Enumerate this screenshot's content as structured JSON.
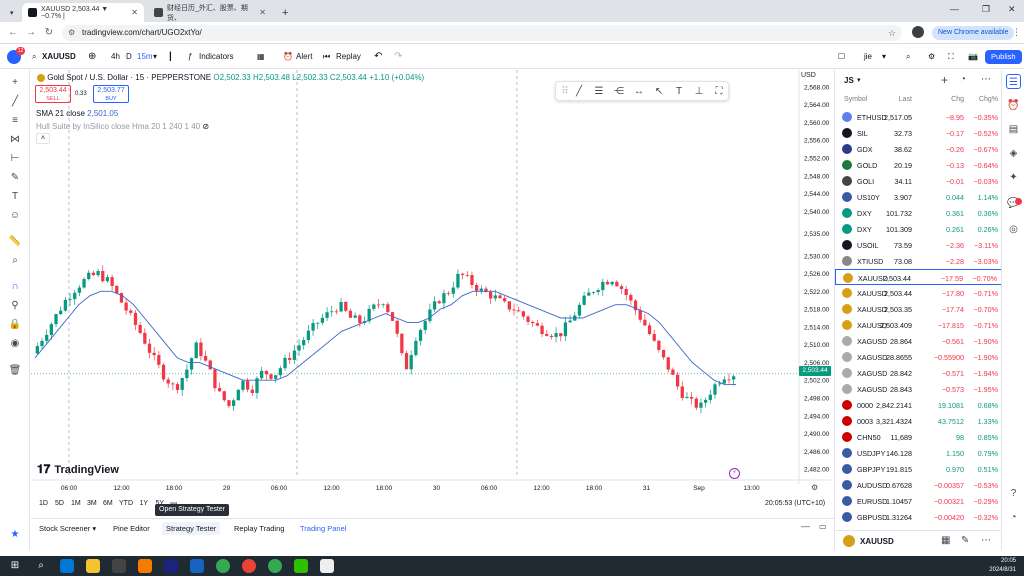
{
  "browser": {
    "tabs": [
      {
        "title": "XAUUSD 2,503.44 ▼ −0.7% |",
        "active": true
      },
      {
        "title": "财经日历_外汇、股票、期货、",
        "active": false
      }
    ],
    "url": "tradingview.com/chart/UGO2xtYo/",
    "new_chrome": "New Chrome available",
    "new_tab_icon": "plus-icon"
  },
  "toolbar": {
    "badge": "12",
    "symbol": "XAUUSD",
    "intervals": [
      "4h",
      "D",
      "15m"
    ],
    "indicators_label": "Indicators",
    "alert_label": "Alert",
    "replay_label": "Replay",
    "user": "jie",
    "publish_label": "Publish"
  },
  "chart": {
    "title": "Gold Spot / U.S. Dollar · 15 · PEPPERSTONE",
    "ohlc": "O2,502.33 H2,503.48 L2,502.33 C2,503.44 +1.10 (+0.04%)",
    "sell_price": "2,503.44",
    "sell_label": "SELL",
    "spread": "0.33",
    "buy_price": "2,503.77",
    "buy_label": "BUY",
    "sma_label": "SMA 21 close",
    "sma_value": "2,501.05",
    "hull_label": "Hull Suite by InSilico close Hma 20 1 240 1 40",
    "currency": "USD",
    "last_price_tag": "2,503.44",
    "logo_text": "TradingView"
  },
  "chart_data": {
    "type": "candlestick",
    "title": "Gold Spot / U.S. Dollar · 15 · PEPPERSTONE",
    "yaxis_ticks": [
      2568,
      2564,
      2560,
      2556,
      2552,
      2548,
      2544,
      2540,
      2535,
      2530,
      2526,
      2522,
      2518,
      2514,
      2510,
      2506,
      2502,
      2498,
      2494,
      2490,
      2486,
      2482
    ],
    "ylim": [
      2480,
      2570
    ],
    "xaxis_ticks": [
      "06:00",
      "12:00",
      "18:00",
      "29",
      "06:00",
      "12:00",
      "18:00",
      "30",
      "06:00",
      "12:00",
      "18:00",
      "31",
      "Sep",
      "13:00"
    ],
    "close_path": [
      2508,
      2512,
      2516,
      2520,
      2523,
      2525,
      2526,
      2524,
      2520,
      2516,
      2512,
      2507,
      2503,
      2500,
      2504,
      2510,
      2505,
      2499,
      2496,
      2502,
      2500,
      2504,
      2503,
      2506,
      2509,
      2512,
      2515,
      2517,
      2519,
      2516,
      2515,
      2518,
      2520,
      2515,
      2504,
      2512,
      2516,
      2520,
      2522,
      2526,
      2524,
      2522,
      2521,
      2519,
      2518,
      2516,
      2514,
      2513,
      2512,
      2515,
      2519,
      2522,
      2524,
      2525,
      2522,
      2518,
      2514,
      2509,
      2505,
      2500,
      2497,
      2496,
      2500,
      2503,
      2503.44
    ],
    "sma_path": [
      2507,
      2510,
      2513,
      2516,
      2519,
      2521,
      2522,
      2522,
      2521,
      2519,
      2516,
      2513,
      2510,
      2507,
      2506,
      2506,
      2505,
      2504,
      2503,
      2502,
      2502,
      2502,
      2502,
      2503,
      2505,
      2507,
      2509,
      2511,
      2513,
      2514,
      2515,
      2516,
      2517,
      2516,
      2515,
      2515,
      2516,
      2518,
      2519,
      2521,
      2522,
      2522,
      2522,
      2521,
      2520,
      2519,
      2518,
      2517,
      2516,
      2516,
      2516,
      2517,
      2518,
      2519,
      2519,
      2518,
      2517,
      2515,
      2512,
      2509,
      2506,
      2504,
      2502,
      2501,
      2501.05
    ],
    "last_price": 2503.44,
    "grid": false
  },
  "range_bar": {
    "ranges": [
      "1D",
      "5D",
      "1M",
      "3M",
      "6M",
      "YTD",
      "1Y",
      "5Y"
    ],
    "time": "20:05:53 (UTC+10)"
  },
  "bottom_tabs": [
    "Stock Screener",
    "Pine Editor",
    "Strategy Tester",
    "Replay Trading",
    "Trading Panel"
  ],
  "tooltip": "Open Strategy Tester",
  "watchlist": {
    "title": "JS",
    "columns": [
      "Symbol",
      "Last",
      "Chg",
      "Chg%"
    ],
    "rows": [
      {
        "sym": "ETHUSD",
        "last": "2,517.05",
        "chg": "−8.95",
        "pct": "−0.35%",
        "up": false,
        "color": "#627eea"
      },
      {
        "sym": "SIL",
        "last": "32.73",
        "chg": "−0.17",
        "pct": "−0.52%",
        "up": false,
        "color": "#131722"
      },
      {
        "sym": "GDX",
        "last": "38.62",
        "chg": "−0.26",
        "pct": "−0.67%",
        "up": false,
        "color": "#2d3a8c"
      },
      {
        "sym": "GOLD",
        "last": "20.19",
        "chg": "−0.13",
        "pct": "−0.64%",
        "up": false,
        "color": "#1c7a3d"
      },
      {
        "sym": "GOLI",
        "last": "34.11",
        "chg": "−0.01",
        "pct": "−0.03%",
        "up": false,
        "color": "#444"
      },
      {
        "sym": "US10Y",
        "last": "3.907",
        "chg": "0.044",
        "pct": "1.14%",
        "up": true,
        "color": "#3c5aa6"
      },
      {
        "sym": "DXY",
        "last": "101.732",
        "chg": "0.361",
        "pct": "0.36%",
        "up": true,
        "color": "#089981"
      },
      {
        "sym": "DXY",
        "last": "101.309",
        "chg": "0.261",
        "pct": "0.26%",
        "up": true,
        "color": "#089981"
      },
      {
        "sym": "USOIL",
        "last": "73.59",
        "chg": "−2.36",
        "pct": "−3.11%",
        "up": false,
        "color": "#131722"
      },
      {
        "sym": "XTIUSD",
        "last": "73.08",
        "chg": "−2.28",
        "pct": "−3.03%",
        "up": false,
        "color": "#888"
      },
      {
        "sym": "XAUUSD",
        "last": "2,503.44",
        "chg": "−17.59",
        "pct": "−0.70%",
        "up": false,
        "color": "#d4a017",
        "selected": true
      },
      {
        "sym": "XAUUSD",
        "last": "2,503.44",
        "chg": "−17.80",
        "pct": "−0.71%",
        "up": false,
        "color": "#d4a017"
      },
      {
        "sym": "XAUUSD",
        "last": "2,503.35",
        "chg": "−17.74",
        "pct": "−0.70%",
        "up": false,
        "color": "#d4a017"
      },
      {
        "sym": "XAUUSD",
        "last": "2,503.409",
        "chg": "−17.815",
        "pct": "−0.71%",
        "up": false,
        "color": "#d4a017"
      },
      {
        "sym": "XAGUSD",
        "last": "28.864",
        "chg": "−0.561",
        "pct": "−1.90%",
        "up": false,
        "color": "#aaa"
      },
      {
        "sym": "XAGUSD",
        "last": "28.8655",
        "chg": "−0.55900",
        "pct": "−1.90%",
        "up": false,
        "color": "#aaa"
      },
      {
        "sym": "XAGUSD",
        "last": "28.842",
        "chg": "−0.571",
        "pct": "−1.94%",
        "up": false,
        "color": "#aaa"
      },
      {
        "sym": "XAGUSD",
        "last": "28.843",
        "chg": "−0.573",
        "pct": "−1.95%",
        "up": false,
        "color": "#aaa"
      },
      {
        "sym": "0000",
        "last": "2,842.2141",
        "chg": "19.1081",
        "pct": "0.68%",
        "up": true,
        "color": "#c00"
      },
      {
        "sym": "0003",
        "last": "3,321.4324",
        "chg": "43.7512",
        "pct": "1.33%",
        "up": true,
        "color": "#c00"
      },
      {
        "sym": "CHN50",
        "last": "11,689",
        "chg": "98",
        "pct": "0.85%",
        "up": true,
        "color": "#c00"
      },
      {
        "sym": "USDJPY",
        "last": "146.128",
        "chg": "1.150",
        "pct": "0.79%",
        "up": true,
        "color": "#3c5aa6"
      },
      {
        "sym": "GBPJPY",
        "last": "191.815",
        "chg": "0.970",
        "pct": "0.51%",
        "up": true,
        "color": "#3c5aa6"
      },
      {
        "sym": "AUDUSD",
        "last": "0.67628",
        "chg": "−0.00357",
        "pct": "−0.53%",
        "up": false,
        "color": "#3c5aa6"
      },
      {
        "sym": "EURUSD",
        "last": "1.10457",
        "chg": "−0.00321",
        "pct": "−0.29%",
        "up": false,
        "color": "#3c5aa6"
      },
      {
        "sym": "GBPUSD",
        "last": "1.31264",
        "chg": "−0.00420",
        "pct": "−0.32%",
        "up": false,
        "color": "#3c5aa6"
      }
    ],
    "footer_symbol": "XAUUSD"
  },
  "taskbar": {
    "time": "20:05",
    "date": "2024/8/31"
  },
  "colors": {
    "up": "#089981",
    "down": "#f23645",
    "sma": "#3a67c9",
    "accent": "#2962ff"
  }
}
